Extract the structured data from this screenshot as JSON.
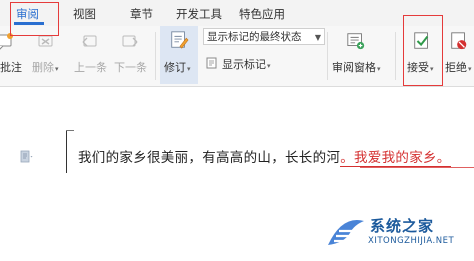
{
  "tabs": [
    {
      "label": "审阅",
      "active": true
    },
    {
      "label": "视图",
      "active": false
    },
    {
      "label": "章节",
      "active": false
    },
    {
      "label": "开发工具",
      "active": false
    },
    {
      "label": "特色应用",
      "active": false
    }
  ],
  "ribbon": {
    "add_comment": {
      "label": "批注",
      "icon": "comment-icon"
    },
    "delete": {
      "label": "删除",
      "icon": "delete-comment-icon",
      "disabled": true
    },
    "previous": {
      "label": "上一条",
      "icon": "previous-comment-icon",
      "disabled": true
    },
    "next": {
      "label": "下一条",
      "icon": "next-comment-icon",
      "disabled": true
    },
    "track_changes": {
      "label": "修订",
      "icon": "track-changes-icon"
    },
    "markup_state": {
      "value": "显示标记的最终状态"
    },
    "show_markup": {
      "label": "显示标记",
      "icon": "show-markup-icon"
    },
    "review_pane": {
      "label": "审阅窗格",
      "icon": "review-pane-icon"
    },
    "accept": {
      "label": "接受",
      "icon": "accept-icon"
    },
    "reject": {
      "label": "拒绝",
      "icon": "reject-icon"
    }
  },
  "document": {
    "text_plain": "我们的家乡很美丽，有高高的山，长长的河",
    "text_inserted": "。我爱我的家乡。"
  },
  "watermark": {
    "title": "系统之家",
    "url": "XITONGZHIJIA.NET"
  },
  "colors": {
    "accent": "#2a6fd0",
    "highlight_red": "#e53b3b",
    "insertion_red": "#d43030",
    "watermark_blue": "#1c5a9c"
  }
}
